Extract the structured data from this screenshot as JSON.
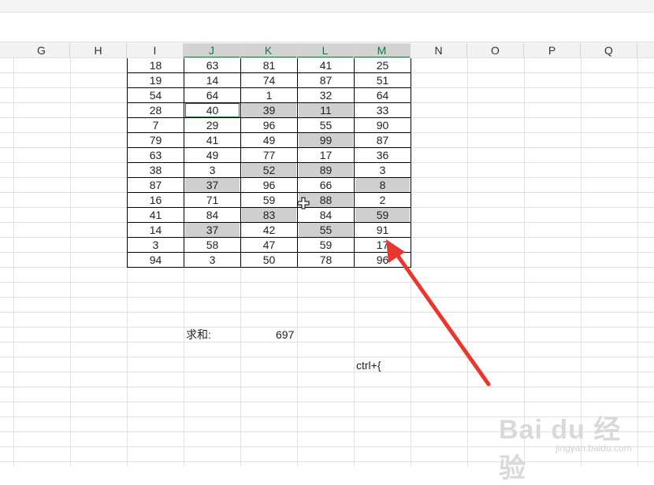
{
  "column_headers": [
    "G",
    "H",
    "I",
    "J",
    "K",
    "L",
    "M",
    "N",
    "O",
    "P",
    "Q"
  ],
  "selected_columns": [
    "J",
    "K",
    "L",
    "M"
  ],
  "table": {
    "rows": [
      [
        18,
        63,
        81,
        41,
        25
      ],
      [
        19,
        14,
        74,
        87,
        51
      ],
      [
        54,
        64,
        1,
        32,
        64
      ],
      [
        28,
        40,
        39,
        11,
        33
      ],
      [
        7,
        29,
        96,
        55,
        90
      ],
      [
        79,
        41,
        49,
        99,
        87
      ],
      [
        63,
        49,
        77,
        17,
        36
      ],
      [
        38,
        3,
        52,
        89,
        3
      ],
      [
        87,
        37,
        96,
        66,
        8
      ],
      [
        16,
        71,
        59,
        88,
        2
      ],
      [
        41,
        84,
        83,
        84,
        59
      ],
      [
        14,
        37,
        42,
        55,
        91
      ],
      [
        3,
        58,
        47,
        59,
        17
      ],
      [
        94,
        3,
        50,
        78,
        96
      ]
    ],
    "highlighted_cells": [
      [
        3,
        2
      ],
      [
        3,
        3
      ],
      [
        5,
        3
      ],
      [
        7,
        2
      ],
      [
        7,
        3
      ],
      [
        8,
        1
      ],
      [
        8,
        4
      ],
      [
        9,
        3
      ],
      [
        10,
        2
      ],
      [
        10,
        4
      ],
      [
        11,
        1
      ],
      [
        11,
        3
      ]
    ],
    "active_cell": [
      3,
      1
    ]
  },
  "sum": {
    "label": "求和:",
    "value": "697"
  },
  "shortcut_text": "ctrl+{",
  "watermark": {
    "brand": "Bai du 经验",
    "url": "jingyan.baidu.com"
  },
  "colors": {
    "accent": "#217346",
    "highlight": "#cfcfcf",
    "arrow": "#e8372f"
  }
}
